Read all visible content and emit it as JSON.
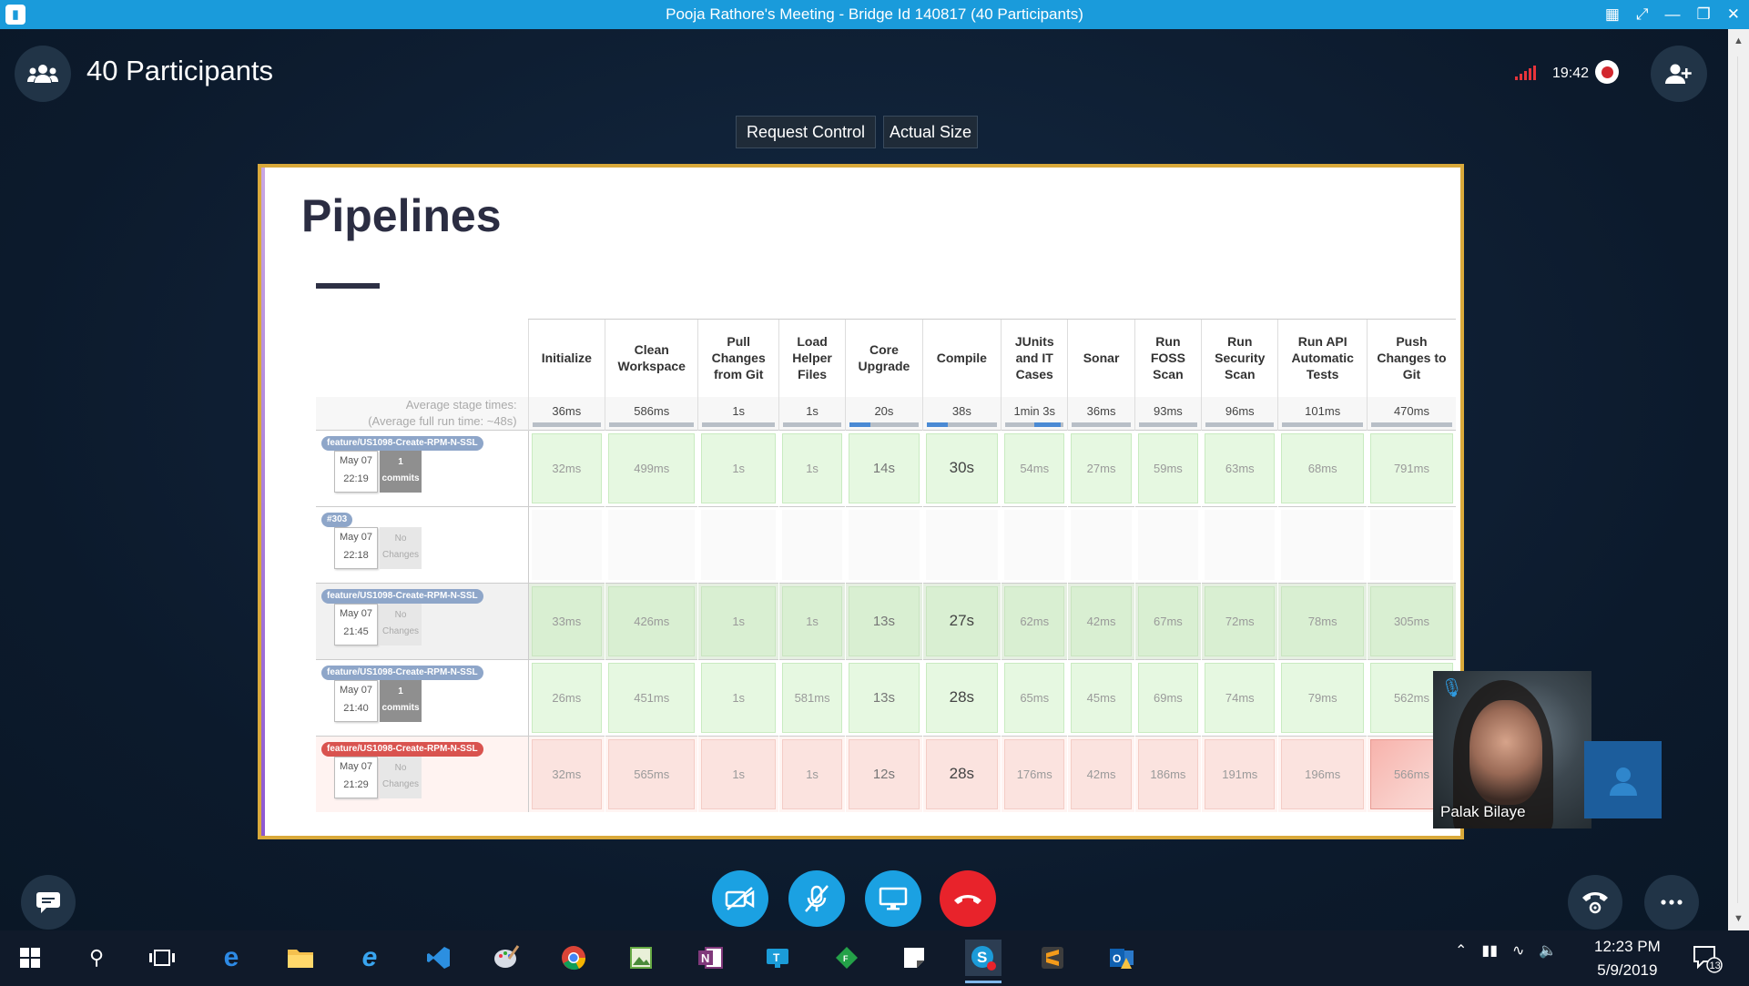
{
  "window": {
    "title": "Pooja Rathore's Meeting - Bridge Id 140817 (40 Participants)"
  },
  "header": {
    "participants_label": "40 Participants",
    "call_time": "19:42"
  },
  "share_controls": {
    "request_control": "Request Control",
    "actual_size": "Actual Size"
  },
  "slide": {
    "title": "Pipelines",
    "avg_label_line1": "Average stage times:",
    "avg_label_line2": "(Average full run time: ~48s)",
    "columns": [
      "Initialize",
      "Clean Workspace",
      "Pull Changes from Git",
      "Load Helper Files",
      "Core Upgrade",
      "Compile",
      "JUnits and IT Cases",
      "Sonar",
      "Run FOSS Scan",
      "Run Security Scan",
      "Run API Automatic Tests",
      "Push Changes to Git"
    ],
    "averages": [
      "36ms",
      "586ms",
      "1s",
      "1s",
      "20s",
      "38s",
      "1min 3s",
      "36ms",
      "93ms",
      "96ms",
      "101ms",
      "470ms"
    ],
    "runs": [
      {
        "branch": "feature/US1098-Create-RPM-N-SSL",
        "date": "May 07",
        "time": "22:19",
        "commits_num": "1",
        "commits_label": "commits",
        "times": [
          "32ms",
          "499ms",
          "1s",
          "1s",
          "14s",
          "30s",
          "54ms",
          "27ms",
          "59ms",
          "63ms",
          "68ms",
          "791ms"
        ]
      },
      {
        "branch": "#303",
        "date": "May 07",
        "time": "22:18",
        "commits_num": "No",
        "commits_label": "Changes",
        "times": [
          "",
          "",
          "",
          "",
          "",
          "",
          "",
          "",
          "",
          "",
          "",
          ""
        ]
      },
      {
        "branch": "feature/US1098-Create-RPM-N-SSL",
        "date": "May 07",
        "time": "21:45",
        "commits_num": "No",
        "commits_label": "Changes",
        "times": [
          "33ms",
          "426ms",
          "1s",
          "1s",
          "13s",
          "27s",
          "62ms",
          "42ms",
          "67ms",
          "72ms",
          "78ms",
          "305ms"
        ]
      },
      {
        "branch": "feature/US1098-Create-RPM-N-SSL",
        "date": "May 07",
        "time": "21:40",
        "commits_num": "1",
        "commits_label": "commits",
        "times": [
          "26ms",
          "451ms",
          "1s",
          "581ms",
          "13s",
          "28s",
          "65ms",
          "45ms",
          "69ms",
          "74ms",
          "79ms",
          "562ms"
        ]
      },
      {
        "branch": "feature/US1098-Create-RPM-N-SSL",
        "date": "May 07",
        "time": "21:29",
        "commits_num": "No",
        "commits_label": "Changes",
        "times": [
          "32ms",
          "565ms",
          "1s",
          "1s",
          "12s",
          "28s",
          "176ms",
          "42ms",
          "186ms",
          "191ms",
          "196ms",
          "566ms"
        ]
      }
    ]
  },
  "video": {
    "participant_name": "Palak Bilaye"
  },
  "taskbar": {
    "time": "12:23 PM",
    "date": "5/9/2019",
    "notifications": "13"
  },
  "colors": {
    "accent": "#1a9bdb",
    "hangup": "#e8232b",
    "call_button": "#1ba1e2",
    "frame": "#d9a93a"
  }
}
